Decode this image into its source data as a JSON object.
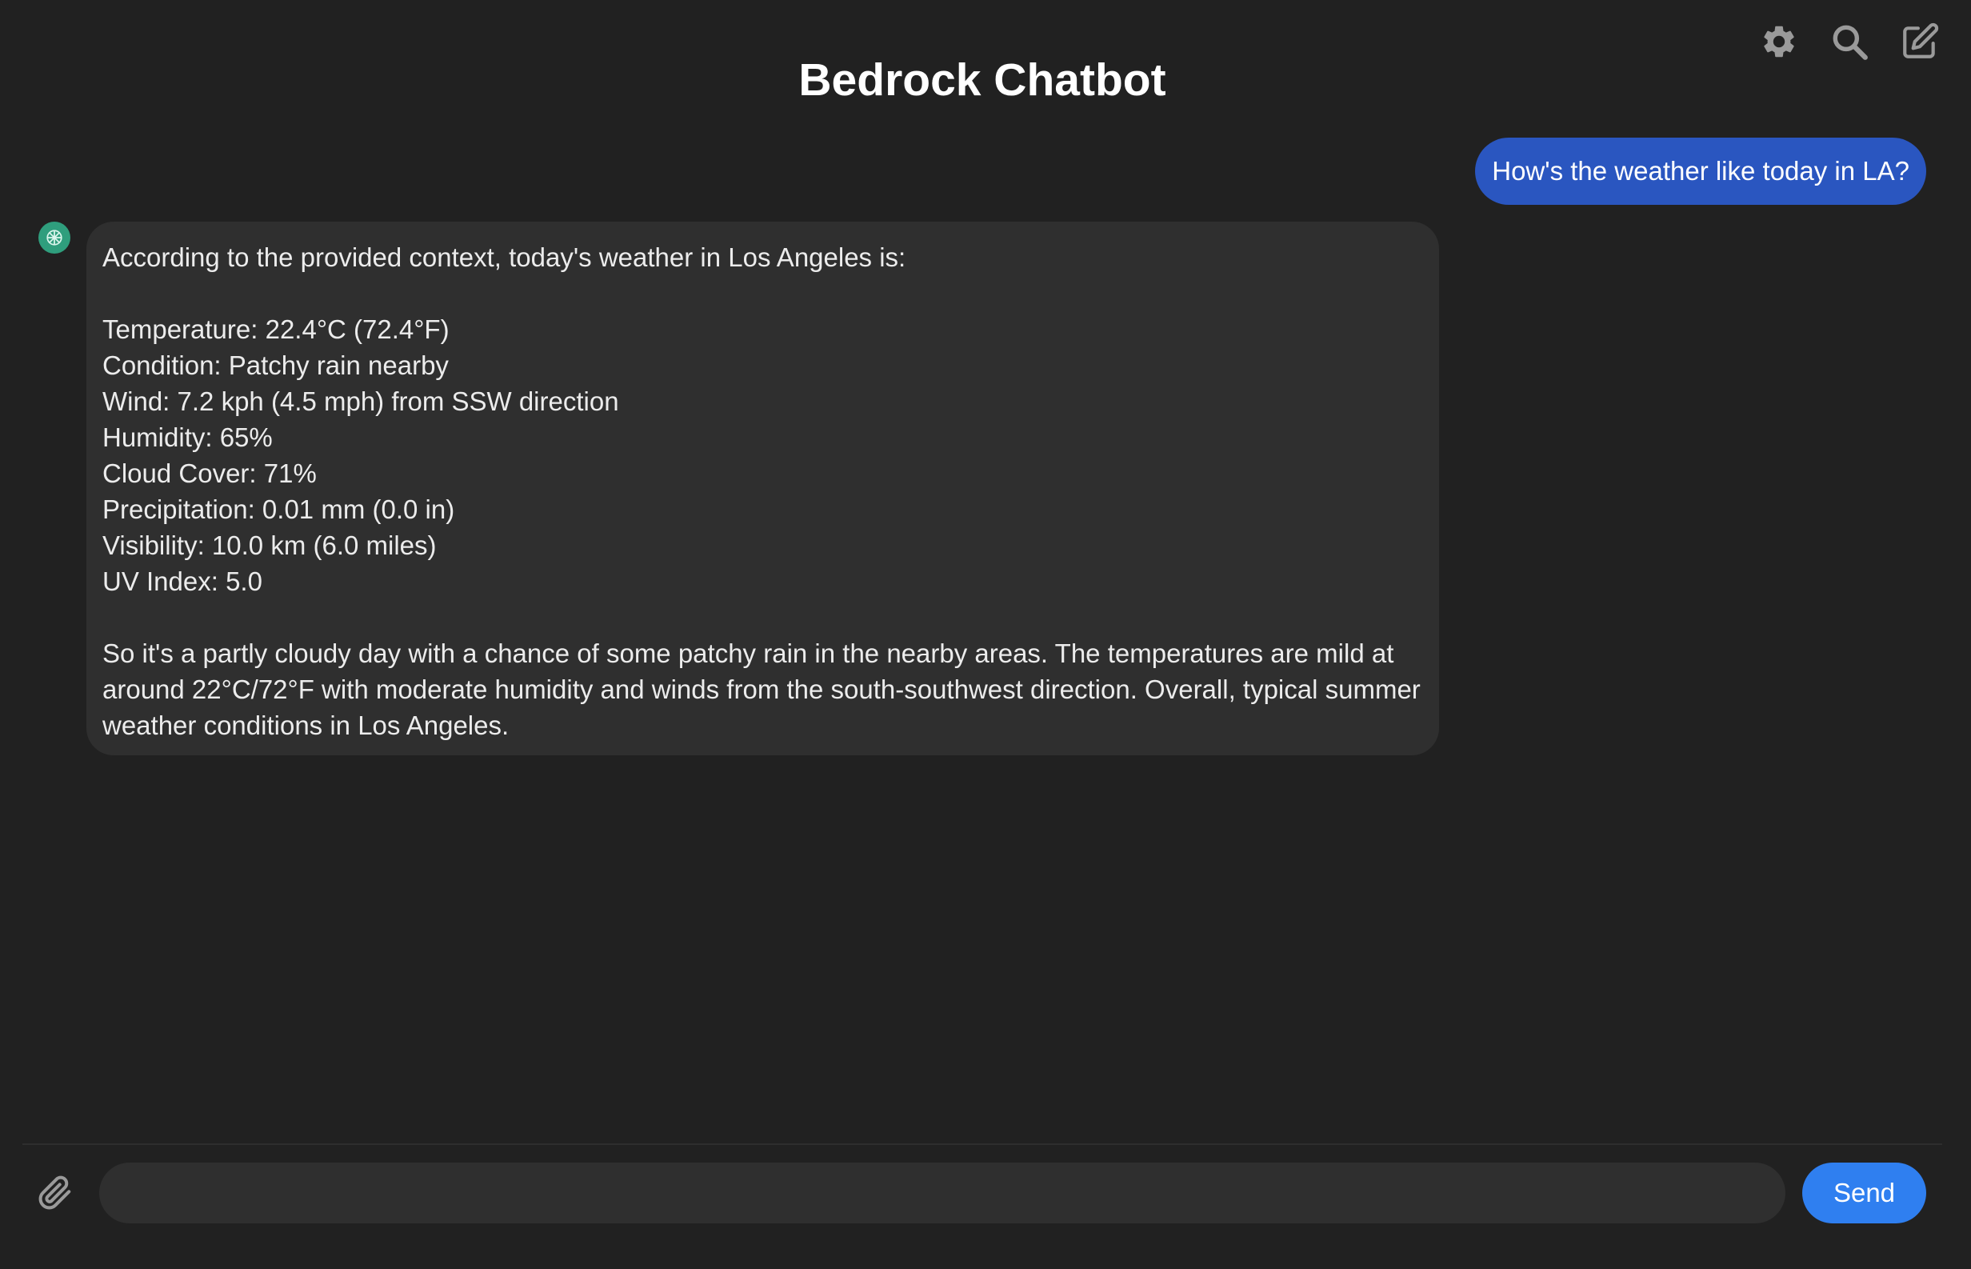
{
  "app": {
    "title": "Bedrock Chatbot"
  },
  "toolbar": {
    "icons": [
      "gear-icon",
      "search-icon",
      "edit-icon"
    ]
  },
  "conversation": {
    "user_message": "How's the weather like today in LA?",
    "bot_message": {
      "intro": "According to the provided context, today's weather in Los Angeles is:",
      "details": [
        "Temperature: 22.4°C (72.4°F)",
        "Condition: Patchy rain nearby",
        "Wind: 7.2 kph (4.5 mph) from SSW direction",
        "Humidity: 65%",
        "Cloud Cover: 71%",
        "Precipitation: 0.01 mm (0.0 in)",
        "Visibility: 10.0 km (6.0 miles)",
        "UV Index: 5.0"
      ],
      "summary": "So it's a partly cloudy day with a chance of some patchy rain in the nearby areas. The temperatures are mild at around 22°C/72°F with moderate humidity and winds from the south-southwest direction. Overall, typical summer weather conditions in Los Angeles."
    }
  },
  "composer": {
    "input_value": "",
    "send_label": "Send"
  },
  "colors": {
    "background": "#212121",
    "user_bubble": "#2a56c0",
    "bot_bubble": "#2f2f2f",
    "send_button": "#2f7ff0",
    "avatar": "#2f9e7d"
  }
}
